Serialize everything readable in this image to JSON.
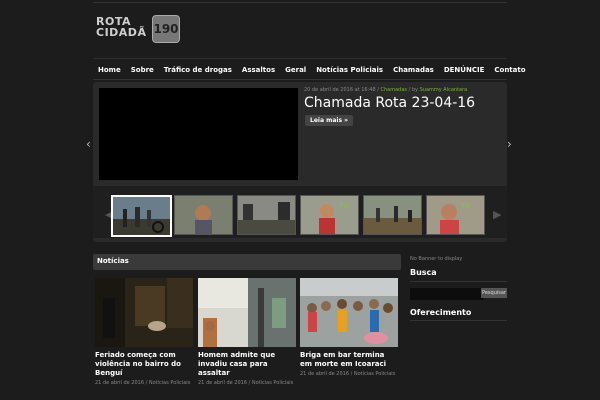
{
  "header": {
    "logo_line1": "ROTA",
    "logo_line2": "CIDADÃ",
    "logo_badge": "190"
  },
  "nav": {
    "items": [
      "Home",
      "Sobre",
      "Tráfico de drogas",
      "Assaltos",
      "Geral",
      "Notícias Policiais",
      "Chamadas",
      "DENÚNCIE",
      "Contato"
    ]
  },
  "slider": {
    "meta_date": "20 de abril de 2016 at 16:48 / ",
    "meta_category": "Chamadas",
    "meta_by": " / by ",
    "meta_author": "Suammy Alcantara",
    "title": "Chamada Rota 23-04-16",
    "more_label": "Leia mais »",
    "arrow_left": "‹",
    "arrow_right": "›"
  },
  "noticias": {
    "heading": "Notícias",
    "cards": [
      {
        "title": "Feriado começa com violência no bairro do Benguí",
        "meta": "21 de abril de 2016 / Notícias Policiais"
      },
      {
        "title": "Homem admite que invadiu casa para assaltar",
        "meta": "21 de abril de 2016 / Notícias Policiais"
      },
      {
        "title": "Briga em bar termina em morte em Icoaraci",
        "meta": "21 de abril de 2016 / Notícias Policiais"
      }
    ]
  },
  "sidebar": {
    "no_banner": "No Banner to display",
    "busca_heading": "Busca",
    "search_button": "Pesquisar",
    "oferecimento_heading": "Oferecimento"
  }
}
